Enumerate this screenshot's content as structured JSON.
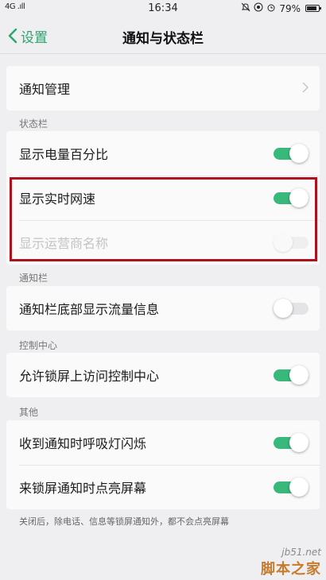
{
  "status_bar": {
    "signal": "4G .ıll",
    "time": "16:34",
    "battery": "79%"
  },
  "nav": {
    "back_label": "设置",
    "title": "通知与状态栏"
  },
  "notification_management": {
    "label": "通知管理"
  },
  "sections": {
    "status_bar": "状态栏",
    "notification_bar": "通知栏",
    "control_center": "控制中心",
    "other": "其他"
  },
  "status_bar_items": [
    {
      "label": "显示电量百分比",
      "on": true,
      "disabled": false
    },
    {
      "label": "显示实时网速",
      "on": true,
      "disabled": false
    },
    {
      "label": "显示运营商名称",
      "on": false,
      "disabled": true
    }
  ],
  "notification_bar_items": [
    {
      "label": "通知栏底部显示流量信息",
      "on": false,
      "disabled": false
    }
  ],
  "control_center_items": [
    {
      "label": "允许锁屏上访问控制中心",
      "on": true,
      "disabled": false
    }
  ],
  "other_items": [
    {
      "label": "收到通知时呼吸灯闪烁",
      "on": true,
      "disabled": false
    },
    {
      "label": "来锁屏通知时点亮屏幕",
      "on": true,
      "disabled": false
    }
  ],
  "footer_note": "关闭后，除电话、信息等锁屏通知外，都不会点亮屏幕",
  "watermark": {
    "top": "jb51.net",
    "bottom": "脚本之家"
  },
  "colors": {
    "accent": "#2aa56c",
    "toggle_on": "#38b87a",
    "highlight_border": "#b0101c"
  }
}
